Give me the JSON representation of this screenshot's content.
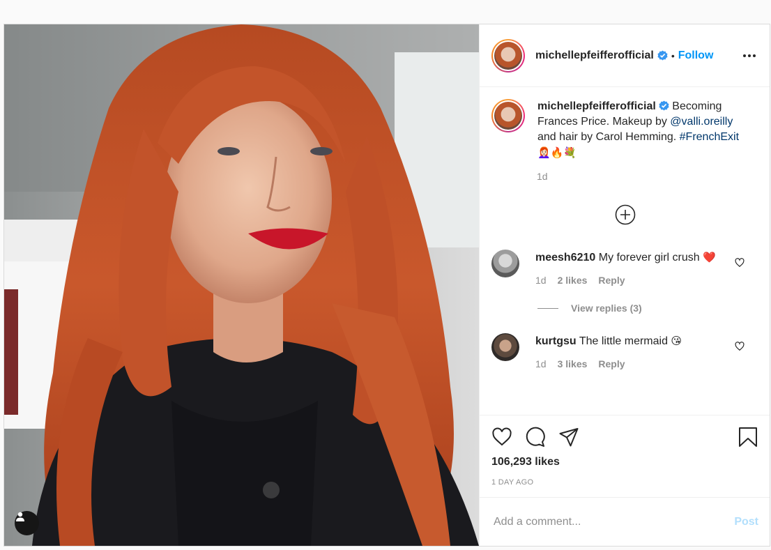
{
  "post": {
    "username": "michellepfeifferofficial",
    "follow_label": "Follow",
    "separator": "•",
    "caption": {
      "username": "michellepfeifferofficial",
      "text_before": " Becoming Frances Price. Makeup by ",
      "mention": "@valli.oreilly",
      "text_after": " and hair by Carol Hemming. ",
      "hashtag": "#FrenchExit",
      "emojis": "👩🏻‍🦰🔥💐",
      "time": "1d"
    },
    "comments": [
      {
        "username": "meesh6210",
        "text": " My forever girl crush",
        "emoji": "❤️",
        "time": "1d",
        "likes": "2 likes",
        "reply_label": "Reply",
        "view_replies": "View replies (3)"
      },
      {
        "username": "kurtgsu",
        "text": " The little mermaid ",
        "emoji": "😘",
        "time": "1d",
        "likes": "3 likes",
        "reply_label": "Reply"
      }
    ],
    "like_count": "106,293 likes",
    "posted_ago": "1 DAY AGO",
    "comment_placeholder": "Add a comment...",
    "post_label": "Post"
  },
  "icons": {
    "verified": "verified-badge-icon",
    "more": "more-options-icon",
    "load_more": "plus-circle-icon",
    "like": "heart-icon",
    "comment": "comment-bubble-icon",
    "share": "paper-plane-icon",
    "save": "bookmark-icon",
    "tag": "user-tag-icon"
  },
  "colors": {
    "link": "#00376b",
    "follow": "#0095f6",
    "post_disabled": "#b2dffc",
    "muted": "#8e8e8e"
  }
}
